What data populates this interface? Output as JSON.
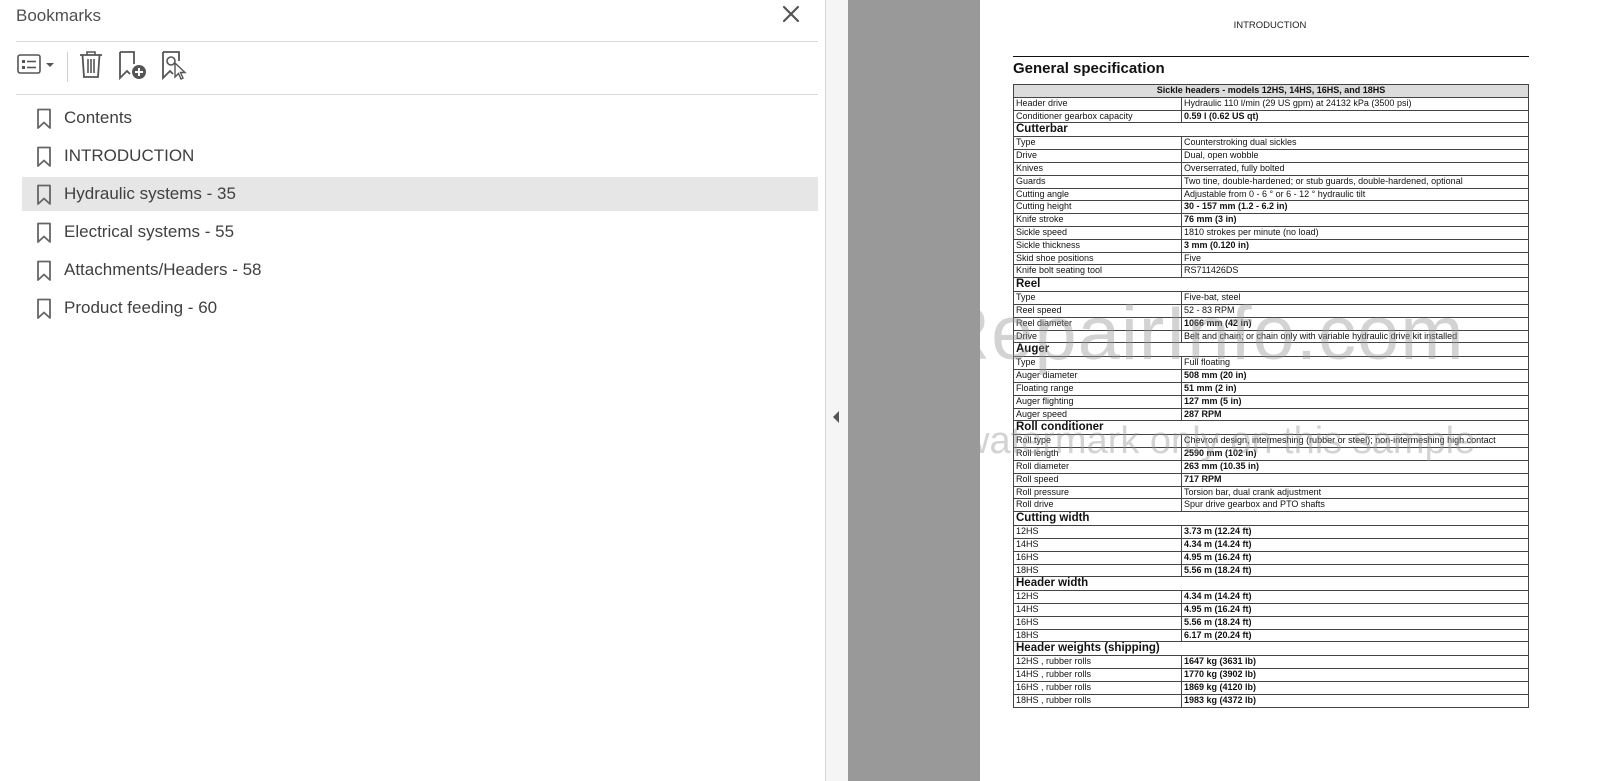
{
  "bookmarks": {
    "title": "Bookmarks",
    "items": [
      {
        "label": "Contents"
      },
      {
        "label": "INTRODUCTION"
      },
      {
        "label": "Hydraulic systems - 35",
        "selected": true
      },
      {
        "label": "Electrical systems - 55"
      },
      {
        "label": "Attachments/Headers - 58"
      },
      {
        "label": "Product feeding - 60"
      }
    ],
    "toolbar": [
      "options-menu-icon",
      "delete-icon",
      "new-bookmark-icon",
      "bookmark-selection-icon"
    ]
  },
  "document": {
    "header": "INTRODUCTION",
    "title": "General specification",
    "table_title": "Sickle headers - models 12HS, 14HS, 16HS, and 18HS",
    "rows": [
      {
        "k": "Header drive",
        "v": "Hydraulic 110 l/min (29 US gpm) at 24132 kPa (3500 psi)"
      },
      {
        "k": "Conditioner gearbox capacity",
        "v": "0.59 l (0.62 US qt)",
        "b": true
      },
      {
        "section": "Cutterbar"
      },
      {
        "k": "Type",
        "v": "Counterstroking dual sickles"
      },
      {
        "k": "Drive",
        "v": "Dual, open wobble"
      },
      {
        "k": "Knives",
        "v": "Overserrated, fully bolted"
      },
      {
        "k": "Guards",
        "v": "Two tine, double-hardened; or stub guards, double-hardened, optional"
      },
      {
        "k": "Cutting angle",
        "v": "Adjustable from 0 - 6 ° or 6 - 12 ° hydraulic tilt"
      },
      {
        "k": "Cutting height",
        "v": "30 - 157 mm (1.2 - 6.2 in)",
        "b": true
      },
      {
        "k": "Knife stroke",
        "v": "76 mm (3 in)",
        "b": true
      },
      {
        "k": "Sickle speed",
        "v": "1810 strokes per minute (no load)"
      },
      {
        "k": "Sickle thickness",
        "v": "3 mm (0.120 in)",
        "b": true
      },
      {
        "k": "Skid shoe positions",
        "v": "Five"
      },
      {
        "k": "Knife bolt seating tool",
        "v": "RS711426DS"
      },
      {
        "section": "Reel"
      },
      {
        "k": "Type",
        "v": "Five-bat, steel"
      },
      {
        "k": "Reel speed",
        "v": "52 - 83 RPM"
      },
      {
        "k": "Reel diameter",
        "v": "1066 mm (42 in)",
        "b": true
      },
      {
        "k": "Drive",
        "v": "Belt and chain; or chain only with variable hydraulic drive kit installed"
      },
      {
        "section": "Auger"
      },
      {
        "k": "Type",
        "v": "Full floating"
      },
      {
        "k": "Auger diameter",
        "v": "508 mm (20 in)",
        "b": true
      },
      {
        "k": "Floating range",
        "v": "51 mm (2 in)",
        "b": true
      },
      {
        "k": "Auger flighting",
        "v": "127 mm (5 in)",
        "b": true
      },
      {
        "k": "Auger speed",
        "v": "287 RPM",
        "b": true
      },
      {
        "section": "Roll conditioner"
      },
      {
        "k": "Roll type",
        "v": "Chevron design, intermeshing (rubber or steel); non-intermeshing high contact"
      },
      {
        "k": "Roll length",
        "v": "2590 mm (102 in)",
        "b": true
      },
      {
        "k": "Roll diameter",
        "v": "263 mm (10.35 in)",
        "b": true
      },
      {
        "k": "Roll speed",
        "v": "717 RPM",
        "b": true
      },
      {
        "k": "Roll pressure",
        "v": "Torsion bar, dual crank adjustment"
      },
      {
        "k": "Roll drive",
        "v": "Spur drive gearbox and PTO shafts"
      },
      {
        "section": "Cutting width"
      },
      {
        "k": "12HS",
        "v": "3.73 m (12.24 ft)",
        "b": true
      },
      {
        "k": "14HS",
        "v": "4.34 m (14.24 ft)",
        "b": true
      },
      {
        "k": "16HS",
        "v": "4.95 m (16.24 ft)",
        "b": true
      },
      {
        "k": "18HS",
        "v": "5.56 m (18.24 ft)",
        "b": true
      },
      {
        "section": "Header width"
      },
      {
        "k": "12HS",
        "v": "4.34 m (14.24 ft)",
        "b": true
      },
      {
        "k": "14HS",
        "v": "4.95 m (16.24 ft)",
        "b": true
      },
      {
        "k": "16HS",
        "v": "5.56 m (18.24 ft)",
        "b": true
      },
      {
        "k": "18HS",
        "v": "6.17 m (20.24 ft)",
        "b": true
      },
      {
        "section": "Header weights (shipping)"
      },
      {
        "k": "12HS , rubber rolls",
        "v": "1647 kg (3631 lb)",
        "b": true
      },
      {
        "k": "14HS , rubber rolls",
        "v": "1770 kg (3902 lb)",
        "b": true
      },
      {
        "k": "16HS , rubber rolls",
        "v": "1869 kg (4120 lb)",
        "b": true
      },
      {
        "k": "18HS , rubber rolls",
        "v": "1983 kg (4372 lb)",
        "b": true
      }
    ],
    "watermark": "eRepairInfo.com",
    "watermark_sub": "watermark only on this sample"
  }
}
